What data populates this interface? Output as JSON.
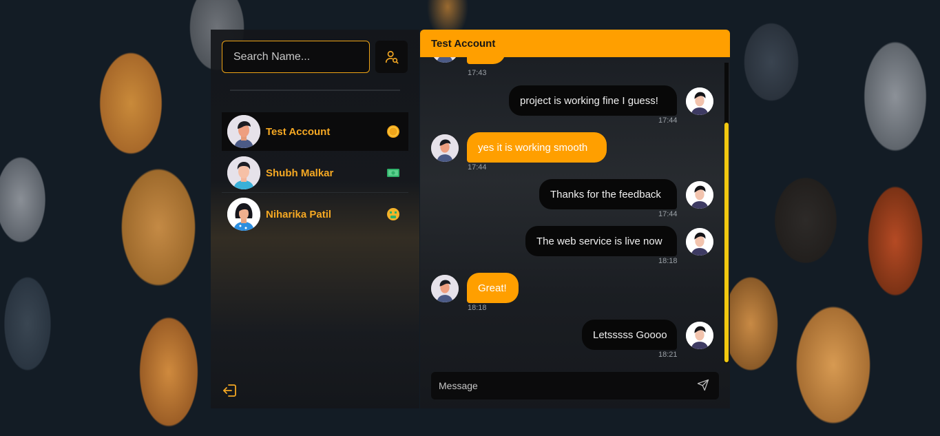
{
  "colors": {
    "accent": "#ff9f00",
    "sidebar_text": "#f5a823",
    "scroll_thumb": "#f2c80f"
  },
  "sidebar": {
    "search": {
      "placeholder": "Search Name...",
      "value": ""
    },
    "search_button_icon": "user-search-icon",
    "contacts": [
      {
        "name": "Test Account",
        "badge": "coin-icon",
        "active": true
      },
      {
        "name": "Shubh Malkar",
        "badge": "money-icon",
        "active": false
      },
      {
        "name": "Niharika Patil",
        "badge": "money-mouth-face-icon",
        "active": false
      }
    ],
    "logout_icon": "logout-icon"
  },
  "chat": {
    "header_title": "Test Account",
    "messages": [
      {
        "from": "them",
        "text": "",
        "time": "17:43"
      },
      {
        "from": "me",
        "text": "project is working fine I guess!",
        "time": "17:44"
      },
      {
        "from": "them",
        "text": "yes it is working smooth",
        "time": "17:44"
      },
      {
        "from": "me",
        "text": "Thanks for the feedback",
        "time": "17:44"
      },
      {
        "from": "me",
        "text": "The web service is live now",
        "time": "18:18"
      },
      {
        "from": "them",
        "text": "Great!",
        "time": "18:18"
      },
      {
        "from": "me",
        "text": "Letsssss Goooo",
        "time": "18:21"
      }
    ],
    "composer": {
      "placeholder": "Message",
      "value": "",
      "send_icon": "send-icon"
    }
  }
}
